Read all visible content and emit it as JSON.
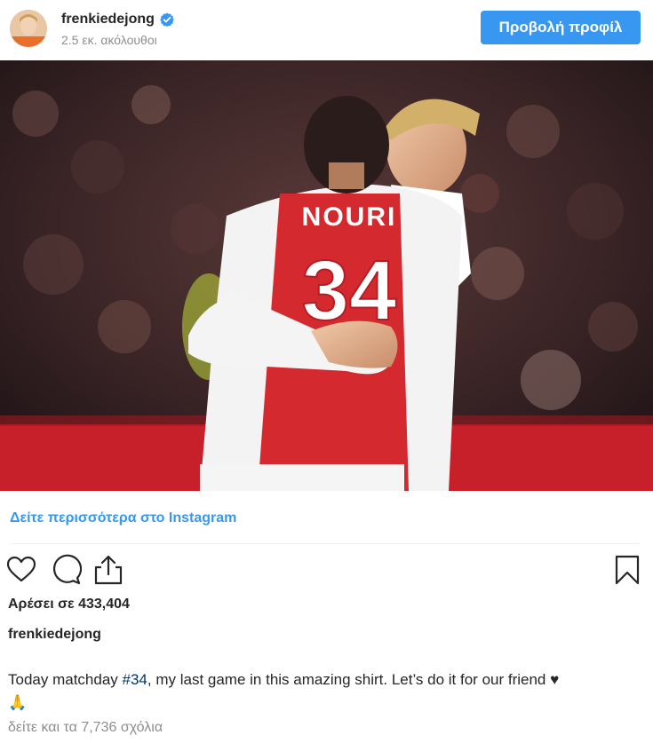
{
  "header": {
    "username": "frenkiedejong",
    "followers": "2.5 εκ. ακόλουθοι",
    "view_profile_label": "Προβολή προφίλ",
    "verified_icon": "verified-badge-icon",
    "accent_color": "#3897f0"
  },
  "photo": {
    "jersey_name": "NOURI",
    "jersey_number": "34"
  },
  "links": {
    "see_more": "Δείτε περισσότερα στο Instagram"
  },
  "actions": {
    "icons": [
      "heart-icon",
      "comment-icon",
      "share-icon",
      "bookmark-icon"
    ]
  },
  "post": {
    "likes": "Αρέσει σε 433,404",
    "caption_user": "frenkiedejong",
    "caption_before": "Today matchday ",
    "hashtag": "#34",
    "caption_after": ", my last game in this amazing shirt. Let’s do it for our friend ♥",
    "caption_emoji": "🙏",
    "comments": "δείτε και τα 7,736 σχόλια"
  }
}
